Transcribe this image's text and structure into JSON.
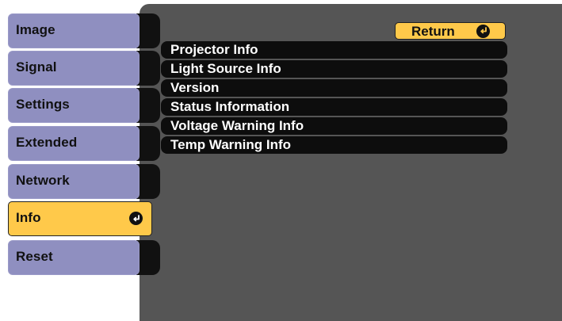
{
  "sidebar": {
    "items": [
      {
        "label": "Image"
      },
      {
        "label": "Signal"
      },
      {
        "label": "Settings"
      },
      {
        "label": "Extended"
      },
      {
        "label": "Network"
      },
      {
        "label": "Info"
      },
      {
        "label": "Reset"
      }
    ],
    "active": "Info"
  },
  "main": {
    "return_label": "Return",
    "submenu": [
      {
        "label": "Projector Info"
      },
      {
        "label": "Light Source Info"
      },
      {
        "label": "Version"
      },
      {
        "label": "Status Information"
      },
      {
        "label": "Voltage Warning Info"
      },
      {
        "label": "Temp Warning Info"
      }
    ]
  },
  "icons": {
    "enter": "enter-icon"
  },
  "colors": {
    "panel": "#555555",
    "sidebar_item": "#8f8fc0",
    "active_item": "#ffc94a",
    "submenu_item": "#0d0d0d",
    "submenu_text": "#ffffff"
  }
}
